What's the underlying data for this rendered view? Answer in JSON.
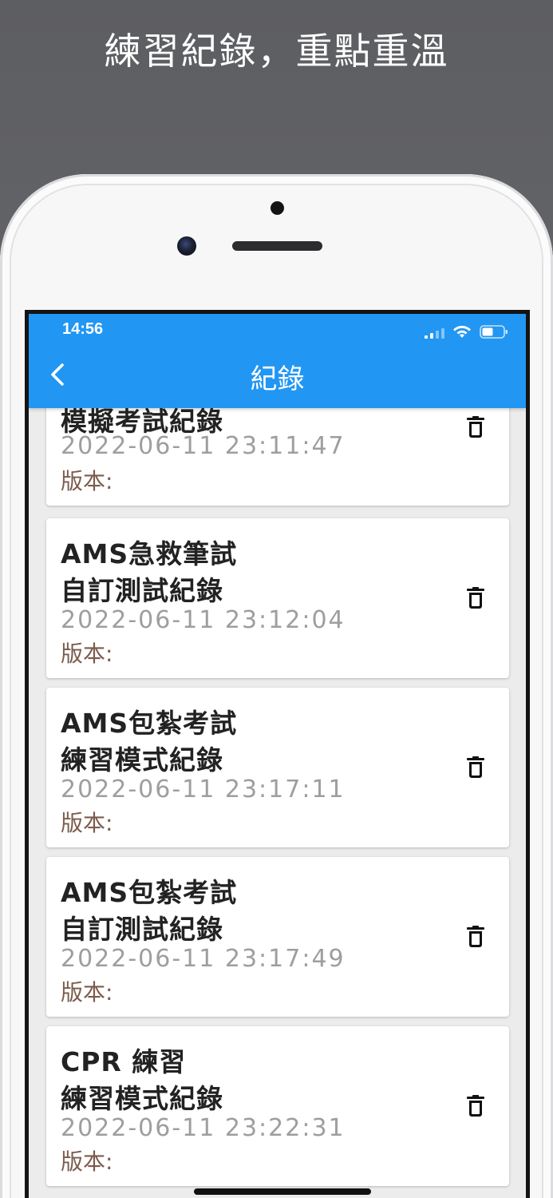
{
  "promo": {
    "caption": "練習紀錄，重點重溫"
  },
  "status_bar": {
    "time": "14:56"
  },
  "header": {
    "title": "紀錄",
    "background_color": "#2196f3",
    "back_icon": "chevron-left-icon"
  },
  "records": [
    {
      "title_line1": "模擬考試紀錄",
      "title_line2": "",
      "date": "2022-06-11 23:11:47",
      "version": "版本:"
    },
    {
      "title_line1": "AMS急救筆試",
      "title_line2": "自訂測試紀錄",
      "date": "2022-06-11 23:12:04",
      "version": "版本:"
    },
    {
      "title_line1": "AMS包紮考試",
      "title_line2": "練習模式紀錄",
      "date": "2022-06-11 23:17:11",
      "version": "版本:"
    },
    {
      "title_line1": "AMS包紮考試",
      "title_line2": "自訂測試紀錄",
      "date": "2022-06-11 23:17:49",
      "version": "版本:"
    },
    {
      "title_line1": "CPR 練習",
      "title_line2": "練習模式紀錄",
      "date": "2022-06-11 23:22:31",
      "version": "版本:"
    }
  ],
  "colors": {
    "title_text": "#222222",
    "date_text": "#9e9e9e",
    "version_text": "#7b5b4c"
  }
}
